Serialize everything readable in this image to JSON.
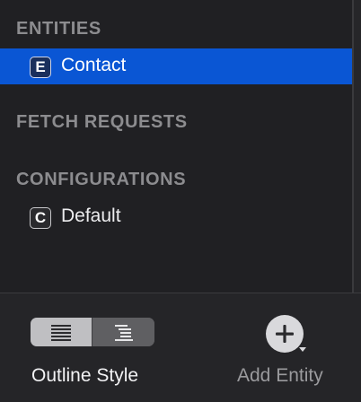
{
  "outline": {
    "sections": {
      "entities": {
        "header": "ENTITIES",
        "items": [
          {
            "badge": "E",
            "label": "Contact",
            "selected": true
          }
        ]
      },
      "fetch_requests": {
        "header": "FETCH REQUESTS"
      },
      "configurations": {
        "header": "CONFIGURATIONS",
        "items": [
          {
            "badge": "C",
            "label": "Default",
            "selected": false
          }
        ]
      }
    },
    "selection_color": "#0a56d4"
  },
  "bottom_bar": {
    "outline_style": {
      "label": "Outline Style",
      "segments": [
        {
          "icon": "list-flat-icon",
          "selected": true
        },
        {
          "icon": "list-hierarchy-icon",
          "selected": false
        }
      ]
    },
    "add_entity": {
      "label": "Add Entity",
      "icon": "plus-circle-dropdown-icon"
    }
  }
}
